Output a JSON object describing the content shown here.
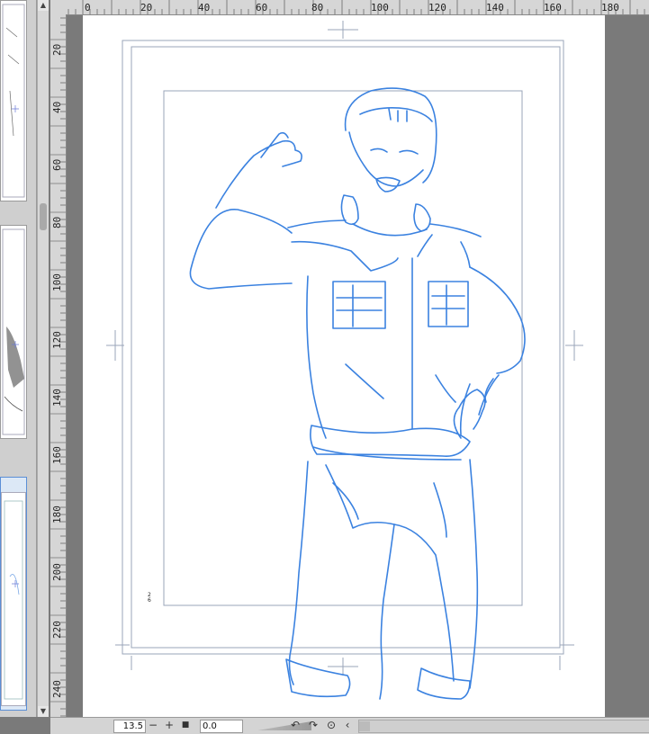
{
  "rulers": {
    "horizontal_labels": [
      "0",
      "20",
      "40",
      "60",
      "80",
      "100",
      "120",
      "140",
      "160",
      "180"
    ],
    "vertical_labels": [
      "20",
      "40",
      "60",
      "80",
      "100",
      "120",
      "140",
      "160",
      "180",
      "200",
      "220",
      "240"
    ]
  },
  "page_strip": {
    "pages": [
      {
        "label": ""
      },
      {
        "label": ""
      },
      {
        "label": ""
      }
    ]
  },
  "canvas": {
    "page_number_text": "2\n6",
    "sketch_color": "#3b82e0"
  },
  "statusbar": {
    "zoom_value": "13.5",
    "rotation_value": "0.0",
    "zoom_out_symbol": "−",
    "zoom_in_symbol": "+",
    "fit_symbol": "■",
    "rotate_left_symbol": "↶",
    "rotate_right_symbol": "↷",
    "reset_rotation_symbol": "⊙",
    "scroll_left_symbol": "‹"
  },
  "colors": {
    "accent": "#5b8fd6",
    "sketch": "#3b82e0",
    "guide": "#9aa4b8"
  }
}
